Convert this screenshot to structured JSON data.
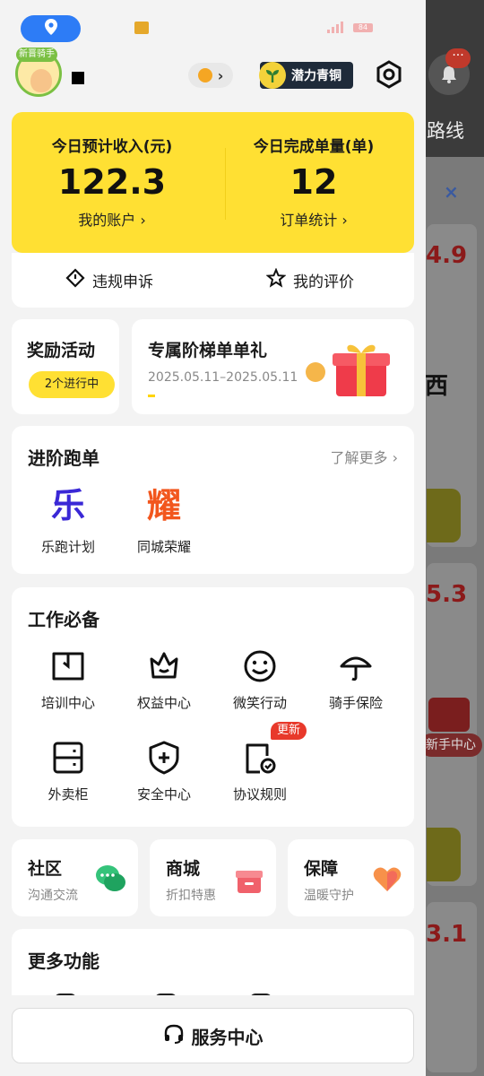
{
  "background": {
    "route_text": "路线",
    "close_glyph": "×",
    "numbers": [
      "4.9",
      "5.3",
      "3.1"
    ],
    "xi_text": "西",
    "newbie_text": "新手中心",
    "bell_badge": "···"
  },
  "status_bar": {
    "battery": "84"
  },
  "profile": {
    "avatar_tag": "新晋骑手",
    "tier_label": "潜力青铜",
    "level_arrow": "›"
  },
  "income": {
    "left_label": "今日预计收入(元)",
    "left_value": "122.3",
    "left_link": "我的账户 ›",
    "right_label": "今日完成单量(单)",
    "right_value": "12",
    "right_link": "订单统计 ›"
  },
  "appeal": {
    "violation": "违规申诉",
    "reviews": "我的评价"
  },
  "reward": {
    "title": "奖励活动",
    "badge": "2个进行中"
  },
  "tier_gift": {
    "title": "专属阶梯单单礼",
    "date": "2025.05.11–2025.05.11"
  },
  "advance": {
    "title": "进阶跑单",
    "more": "了解更多 ›",
    "items": [
      {
        "glyph": "乐",
        "label": "乐跑计划",
        "color": "#3a28d6"
      },
      {
        "glyph": "耀",
        "label": "同城荣耀",
        "color": "#f2561d"
      }
    ]
  },
  "tools": {
    "title": "工作必备",
    "items": [
      {
        "label": "培训中心",
        "icon": "book-icon"
      },
      {
        "label": "权益中心",
        "icon": "crown-icon"
      },
      {
        "label": "微笑行动",
        "icon": "smile-icon"
      },
      {
        "label": "骑手保险",
        "icon": "umbrella-icon"
      },
      {
        "label": "外卖柜",
        "icon": "locker-icon"
      },
      {
        "label": "安全中心",
        "icon": "shield-plus-icon"
      },
      {
        "label": "协议规则",
        "icon": "document-check-icon",
        "badge": "更新"
      }
    ]
  },
  "mini_cards": [
    {
      "title": "社区",
      "sub": "沟通交流",
      "icon": "chat-bubbles-icon"
    },
    {
      "title": "商城",
      "sub": "折扣特惠",
      "icon": "gift-box-icon"
    },
    {
      "title": "保障",
      "sub": "温暖守护",
      "icon": "heart-shield-icon"
    }
  ],
  "more": {
    "title": "更多功能"
  },
  "bottom": {
    "service": "服务中心"
  },
  "colors": {
    "accent_yellow": "#ffe033",
    "location_blue": "#2d7cf6",
    "badge_red": "#e8392b"
  }
}
